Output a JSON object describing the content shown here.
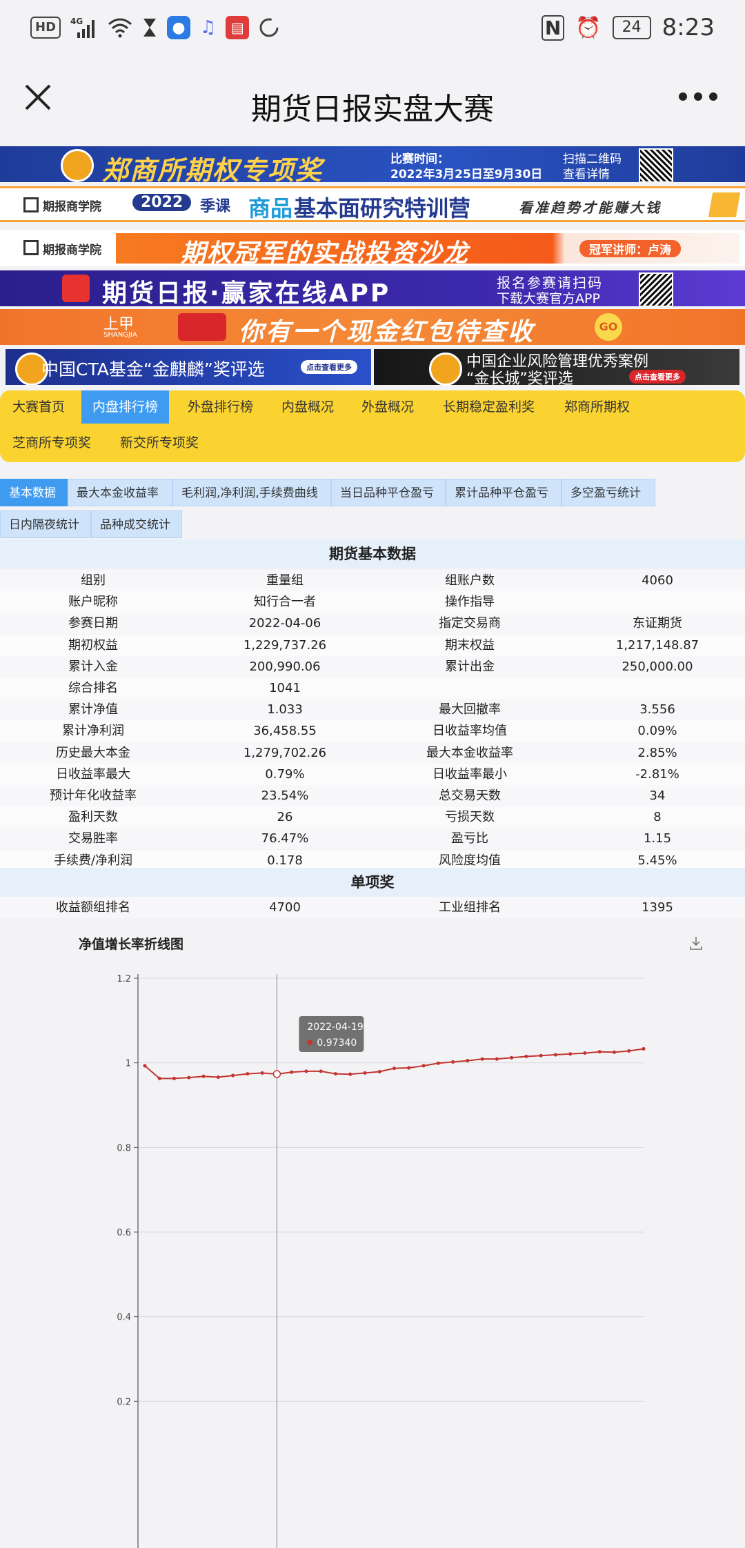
{
  "status_bar": {
    "hd": "HD",
    "network": "4G",
    "battery": "24",
    "time": "8:23"
  },
  "app_bar": {
    "title": "期货日报实盘大赛"
  },
  "banners": {
    "b1": {
      "headline": "郑商所期权专项奖",
      "info_line1": "比赛时间：",
      "info_line2": "2022年3月25日至9月30日",
      "qr_line1": "扫描二维码",
      "qr_line2": "查看详情"
    },
    "b2": {
      "brand": "期报商学院",
      "year": "2022",
      "season": "季课",
      "headline_a": "商品",
      "headline_b": "基本面研究特训营",
      "slogan": "看准趋势才能赚大钱"
    },
    "b3": {
      "brand": "期报商学院",
      "headline": "期权冠军的实战投资沙龙",
      "speaker": "冠军讲师：卢涛"
    },
    "b4": {
      "headline": "期货日报·赢家在线APP",
      "line1": "报名参赛请扫码",
      "line2": "下载大赛官方APP"
    },
    "b5": {
      "brand": "上甲",
      "brand_en": "SHANGJIA",
      "headline": "你有一个现金红包待查收",
      "go": "GO"
    },
    "b6": {
      "left_text": "中国CTA基金“金麒麟”奖评选",
      "left_btn": "点击查看更多",
      "right_line1": "中国企业风险管理优秀案例",
      "right_line2": "“金长城”奖评选",
      "right_btn": "点击查看更多"
    }
  },
  "nav": {
    "items": [
      "大赛首页",
      "内盘排行榜",
      "外盘排行榜",
      "内盘概况",
      "外盘概况",
      "长期稳定盈利奖",
      "郑商所期权",
      "芝商所专项奖",
      "新交所专项奖"
    ]
  },
  "subtabs": [
    "基本数据",
    "最大本金收益率",
    "毛利润,净利润,手续费曲线",
    "当日品种平仓盈亏",
    "累计品种平仓盈亏",
    "多空盈亏统计",
    "日内隔夜统计",
    "品种成交统计"
  ],
  "table": {
    "title": "期货基本数据",
    "rows": [
      [
        "组别",
        "重量组",
        "组账户数",
        "4060"
      ],
      [
        "账户昵称",
        "知行合一者",
        "操作指导",
        ""
      ],
      [
        "参赛日期",
        "2022-04-06",
        "指定交易商",
        "东证期货"
      ],
      [
        "期初权益",
        "1,229,737.26",
        "期末权益",
        "1,217,148.87"
      ],
      [
        "累计入金",
        "200,990.06",
        "累计出金",
        "250,000.00"
      ],
      [
        "综合排名",
        "1041",
        "",
        ""
      ],
      [
        "累计净值",
        "1.033",
        "最大回撤率",
        "3.556"
      ],
      [
        "累计净利润",
        "36,458.55",
        "日收益率均值",
        "0.09%"
      ],
      [
        "历史最大本金",
        "1,279,702.26",
        "最大本金收益率",
        "2.85%"
      ],
      [
        "日收益率最大",
        "0.79%",
        "日收益率最小",
        "-2.81%"
      ],
      [
        "预计年化收益率",
        "23.54%",
        "总交易天数",
        "34"
      ],
      [
        "盈利天数",
        "26",
        "亏损天数",
        "8"
      ],
      [
        "交易胜率",
        "76.47%",
        "盈亏比",
        "1.15"
      ],
      [
        "手续费/净利润",
        "0.178",
        "风险度均值",
        "5.45%"
      ]
    ],
    "award_title": "单项奖",
    "award_row": [
      "收益额组排名",
      "4700",
      "工业组排名",
      "1395"
    ]
  },
  "chart_data": {
    "type": "line",
    "title": "净值增长率折线图",
    "y_ticks": [
      "1.2",
      "1",
      "0.8",
      "0.6",
      "0.4",
      "0.2"
    ],
    "ylim": [
      0,
      1.2
    ],
    "grid": true,
    "values": [
      0.993,
      0.963,
      0.963,
      0.965,
      0.968,
      0.966,
      0.97,
      0.974,
      0.976,
      0.9734,
      0.978,
      0.98,
      0.98,
      0.974,
      0.973,
      0.976,
      0.979,
      0.987,
      0.988,
      0.993,
      0.999,
      1.002,
      1.005,
      1.009,
      1.009,
      1.012,
      1.015,
      1.017,
      1.019,
      1.021,
      1.023,
      1.026,
      1.025,
      1.028,
      1.033
    ],
    "highlight_index": 9,
    "tooltip": {
      "date": "2022-04-19",
      "value": "0.97340"
    },
    "line_color": "#c23531"
  }
}
